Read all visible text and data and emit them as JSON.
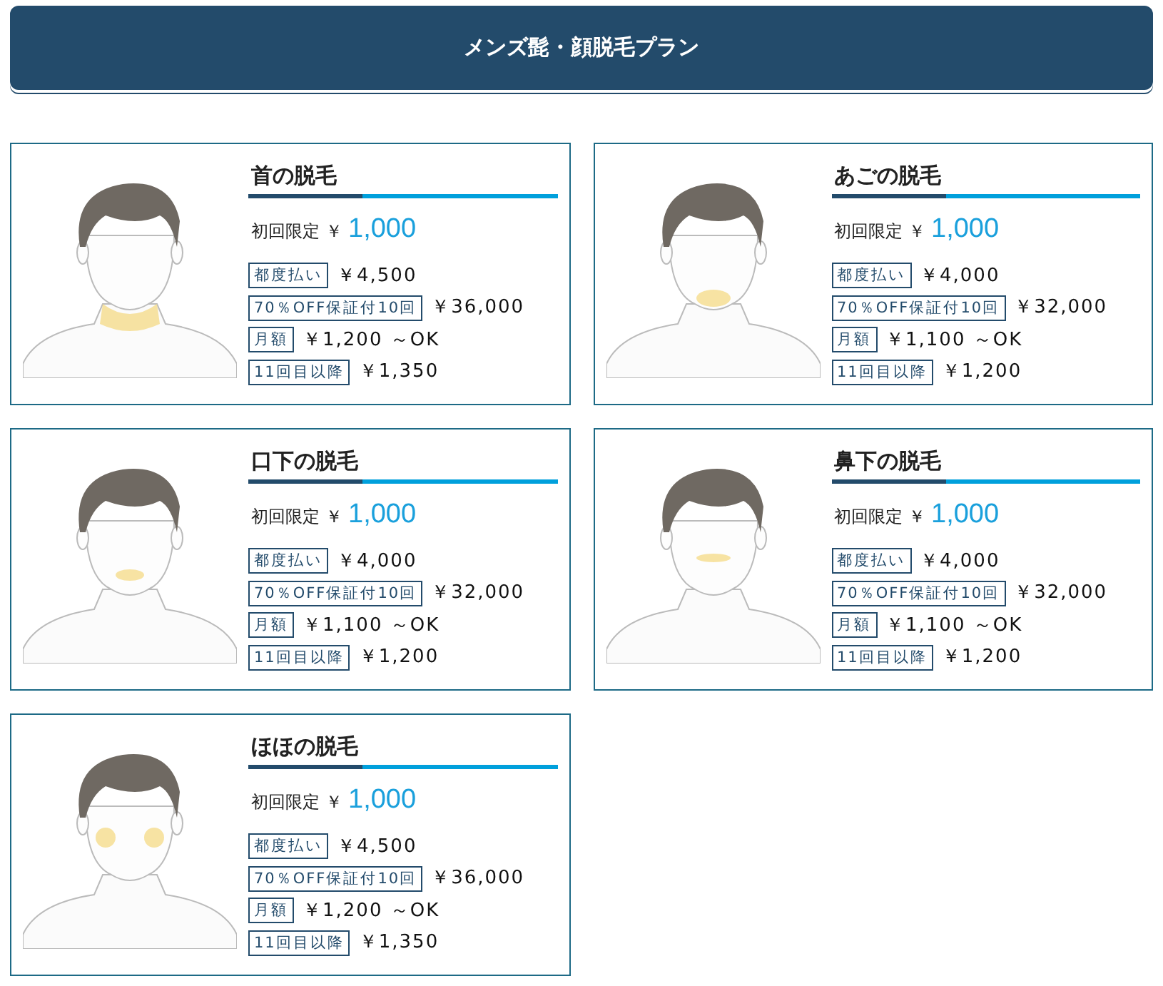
{
  "header": {
    "title": "メンズ髭・顔脱毛プラン"
  },
  "plans": [
    {
      "title": "首の脱毛",
      "kind": "neck",
      "intro_label": "初回限定",
      "intro_currency": "￥",
      "intro_price": "1,000",
      "prices": [
        {
          "tag": "都度払い",
          "price": "￥4,500"
        },
        {
          "tag": "70％OFF保証付10回",
          "price": "￥36,000"
        },
        {
          "tag": "月額",
          "price": "￥1,200 ～OK"
        },
        {
          "tag": "11回目以降",
          "price": "￥1,350"
        }
      ]
    },
    {
      "title": "あごの脱毛",
      "kind": "chin",
      "intro_label": "初回限定",
      "intro_currency": "￥",
      "intro_price": "1,000",
      "prices": [
        {
          "tag": "都度払い",
          "price": "￥4,000"
        },
        {
          "tag": "70％OFF保証付10回",
          "price": "￥32,000"
        },
        {
          "tag": "月額",
          "price": "￥1,100 ～OK"
        },
        {
          "tag": "11回目以降",
          "price": "￥1,200"
        }
      ]
    },
    {
      "title": "口下の脱毛",
      "kind": "lip",
      "intro_label": "初回限定",
      "intro_currency": "￥",
      "intro_price": "1,000",
      "prices": [
        {
          "tag": "都度払い",
          "price": "￥4,000"
        },
        {
          "tag": "70％OFF保証付10回",
          "price": "￥32,000"
        },
        {
          "tag": "月額",
          "price": "￥1,100 ～OK"
        },
        {
          "tag": "11回目以降",
          "price": "￥1,200"
        }
      ]
    },
    {
      "title": "鼻下の脱毛",
      "kind": "nose",
      "intro_label": "初回限定",
      "intro_currency": "￥",
      "intro_price": "1,000",
      "prices": [
        {
          "tag": "都度払い",
          "price": "￥4,000"
        },
        {
          "tag": "70％OFF保証付10回",
          "price": "￥32,000"
        },
        {
          "tag": "月額",
          "price": "￥1,100 ～OK"
        },
        {
          "tag": "11回目以降",
          "price": "￥1,200"
        }
      ]
    },
    {
      "title": "ほほの脱毛",
      "kind": "cheeks",
      "intro_label": "初回限定",
      "intro_currency": "￥",
      "intro_price": "1,000",
      "prices": [
        {
          "tag": "都度払い",
          "price": "￥4,500"
        },
        {
          "tag": "70％OFF保証付10回",
          "price": "￥36,000"
        },
        {
          "tag": "月額",
          "price": "￥1,200 ～OK"
        },
        {
          "tag": "11回目以降",
          "price": "￥1,350"
        }
      ]
    }
  ]
}
